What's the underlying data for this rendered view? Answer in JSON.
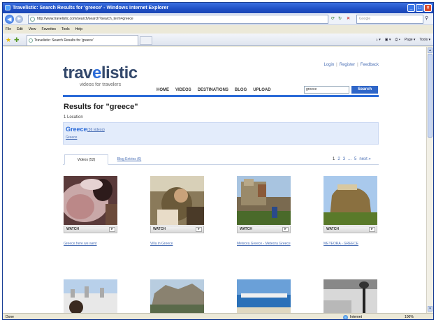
{
  "window": {
    "title": "Travelistic: Search Results for 'greece' - Windows Internet Explorer",
    "minimize": "_",
    "maximize": "□",
    "close": "×"
  },
  "address_bar": {
    "back": "◀",
    "forward": "▶",
    "url": "http://www.travelistic.com/search/search?search_term=greece",
    "search_placeholder": "Google",
    "go": "⚲"
  },
  "menu": [
    "File",
    "Edit",
    "View",
    "Favorites",
    "Tools",
    "Help"
  ],
  "tab": {
    "label": "Travelistic: Search Results for 'greece'",
    "commands": [
      "⌂ ▾",
      "▣ ▾",
      "⎙ ▾",
      "Page ▾",
      "Tools ▾"
    ]
  },
  "site": {
    "logo_main": "trav",
    "logo_accent": "e",
    "logo_rest": "listic",
    "tagline": "videos for travelers",
    "top_links": [
      "Login",
      "Register",
      "Feedback"
    ],
    "nav": [
      "HOME",
      "VIDEOS",
      "DESTINATIONS",
      "BLOG",
      "UPLOAD"
    ],
    "search_value": "greece",
    "search_button": "Search"
  },
  "results": {
    "title": "Results for \"greece\"",
    "location_count": "1 Location",
    "location_name": "Greece",
    "location_videos": "(36 videos)",
    "location_sub": "Greece",
    "tab_videos": "Videos (52)",
    "tab_blog": "Blog Entries (6)",
    "pager": [
      "1",
      "2",
      "3",
      "...",
      "5",
      "next »"
    ],
    "watch_label": "WATCH",
    "play": "▸",
    "cards": [
      {
        "title": "Greece here we went"
      },
      {
        "title": "Villa in Greece"
      },
      {
        "title": "Meteora Greece - Meteora Greece"
      },
      {
        "title": "METEORA - GREECE"
      }
    ]
  },
  "statusbar": {
    "left": "Done",
    "zone": "Internet",
    "zoom": "100%"
  }
}
